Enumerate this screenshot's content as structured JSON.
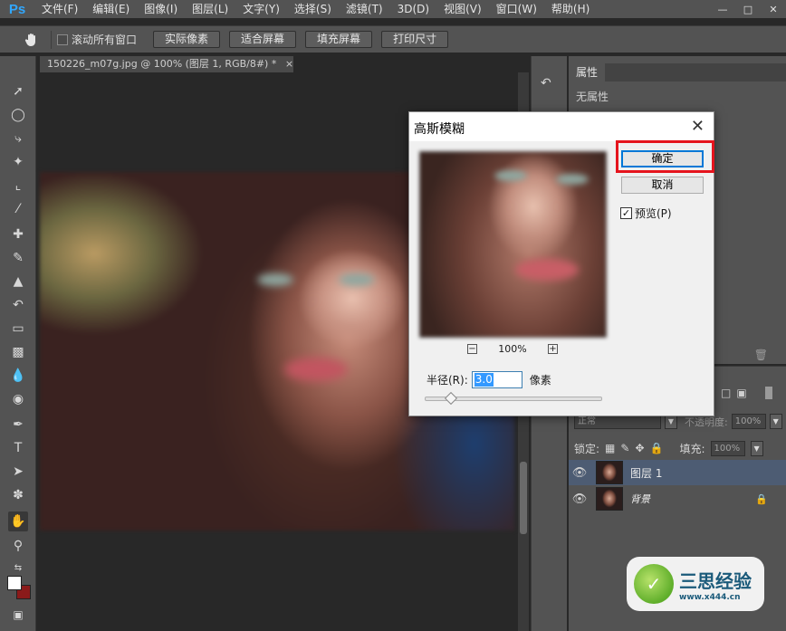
{
  "app": {
    "logo": "Ps"
  },
  "menu": [
    "文件(F)",
    "编辑(E)",
    "图像(I)",
    "图层(L)",
    "文字(Y)",
    "选择(S)",
    "滤镜(T)",
    "3D(D)",
    "视图(V)",
    "窗口(W)",
    "帮助(H)"
  ],
  "options": {
    "scroll_all": "滚动所有窗口",
    "buttons": [
      "实际像素",
      "适合屏幕",
      "填充屏幕",
      "打印尺寸"
    ]
  },
  "document": {
    "tab_title": "150226_m07g.jpg @ 100% (图层 1, RGB/8#) *",
    "close": "×"
  },
  "properties": {
    "tab": "属性",
    "empty": "无属性"
  },
  "layers": {
    "blend": "正常",
    "opacity_label": "不透明度:",
    "opacity": "100%",
    "lock_label": "锁定:",
    "fill_label": "填充:",
    "fill": "100%",
    "items": [
      {
        "name": "图层 1",
        "selected": true
      },
      {
        "name": "背景",
        "locked": true
      }
    ]
  },
  "dialog": {
    "title": "高斯模糊",
    "close": "✕",
    "ok": "确定",
    "cancel": "取消",
    "preview_label": "预览(P)",
    "preview_checked": true,
    "zoom": "100%",
    "radius_label": "半径(R):",
    "radius_value": "3.0",
    "radius_unit": "像素"
  },
  "watermark": {
    "text": "三思经验",
    "url": "www.x444.cn"
  },
  "colors": {
    "ps_blue": "#31a8ff",
    "highlight_red": "#e5141d",
    "panel": "#535353",
    "bg": "#282828"
  }
}
